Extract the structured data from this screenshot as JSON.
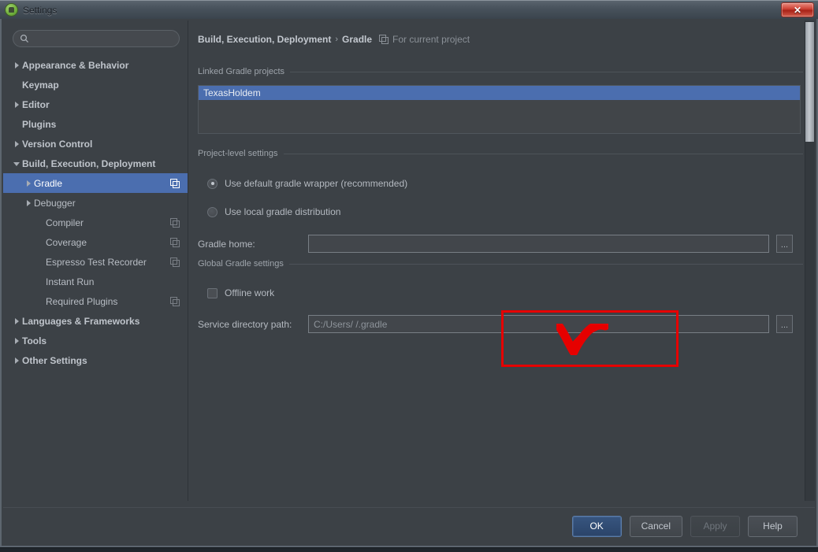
{
  "window": {
    "title": "Settings",
    "app_icon": "android-studio-icon",
    "close_label": "✕"
  },
  "sidebar": {
    "search": {
      "placeholder": "",
      "icon": "search-icon"
    },
    "items": [
      {
        "label": "Appearance & Behavior",
        "depth": 0,
        "arrow": "closed",
        "bold": true,
        "selected": false,
        "scope_icon": false
      },
      {
        "label": "Keymap",
        "depth": 0,
        "arrow": "none",
        "bold": true,
        "selected": false,
        "scope_icon": false
      },
      {
        "label": "Editor",
        "depth": 0,
        "arrow": "closed",
        "bold": true,
        "selected": false,
        "scope_icon": false
      },
      {
        "label": "Plugins",
        "depth": 0,
        "arrow": "none",
        "bold": true,
        "selected": false,
        "scope_icon": false
      },
      {
        "label": "Version Control",
        "depth": 0,
        "arrow": "closed",
        "bold": true,
        "selected": false,
        "scope_icon": false
      },
      {
        "label": "Build, Execution, Deployment",
        "depth": 0,
        "arrow": "open",
        "bold": true,
        "selected": false,
        "scope_icon": false
      },
      {
        "label": "Gradle",
        "depth": 1,
        "arrow": "closed",
        "bold": false,
        "selected": true,
        "scope_icon": true
      },
      {
        "label": "Debugger",
        "depth": 1,
        "arrow": "closed",
        "bold": false,
        "selected": false,
        "scope_icon": false
      },
      {
        "label": "Compiler",
        "depth": 2,
        "arrow": "none",
        "bold": false,
        "selected": false,
        "scope_icon": true
      },
      {
        "label": "Coverage",
        "depth": 2,
        "arrow": "none",
        "bold": false,
        "selected": false,
        "scope_icon": true
      },
      {
        "label": "Espresso Test Recorder",
        "depth": 2,
        "arrow": "none",
        "bold": false,
        "selected": false,
        "scope_icon": true
      },
      {
        "label": "Instant Run",
        "depth": 2,
        "arrow": "none",
        "bold": false,
        "selected": false,
        "scope_icon": false
      },
      {
        "label": "Required Plugins",
        "depth": 2,
        "arrow": "none",
        "bold": false,
        "selected": false,
        "scope_icon": true
      },
      {
        "label": "Languages & Frameworks",
        "depth": 0,
        "arrow": "closed",
        "bold": true,
        "selected": false,
        "scope_icon": false
      },
      {
        "label": "Tools",
        "depth": 0,
        "arrow": "closed",
        "bold": true,
        "selected": false,
        "scope_icon": false
      },
      {
        "label": "Other Settings",
        "depth": 0,
        "arrow": "closed",
        "bold": true,
        "selected": false,
        "scope_icon": false
      }
    ]
  },
  "breadcrumb": {
    "parent": "Build, Execution, Deployment",
    "separator": "›",
    "current": "Gradle",
    "scope_icon": "project-scope-icon",
    "scope_note": "For current project"
  },
  "linked_projects": {
    "group_title": "Linked Gradle projects",
    "items": [
      {
        "label": "TexasHoldem",
        "selected": true
      }
    ]
  },
  "project_level": {
    "group_title": "Project-level settings",
    "radios": [
      {
        "label": "Use default gradle wrapper (recommended)",
        "checked": true
      },
      {
        "label": "Use local gradle distribution",
        "checked": false
      }
    ],
    "gradle_home": {
      "label": "Gradle home:",
      "value": "",
      "placeholder": "",
      "browse_label": "..."
    }
  },
  "global_settings": {
    "group_title": "Global Gradle settings",
    "offline_work": {
      "label": "Offline work",
      "checked": false
    },
    "service_directory": {
      "label": "Service directory path:",
      "value": "C:/Users/          /.gradle",
      "value_visible_prefix": "C:/Users/",
      "value_visible_suffix": "/.gradle",
      "browse_label": "..."
    }
  },
  "annotation": {
    "shape": "rectangle",
    "color": "#e60000",
    "scribble": "redaction-scribble-over-username"
  },
  "footer": {
    "buttons": [
      {
        "label": "OK",
        "style": "default",
        "enabled": true
      },
      {
        "label": "Cancel",
        "style": "normal",
        "enabled": true
      },
      {
        "label": "Apply",
        "style": "disabled",
        "enabled": false
      },
      {
        "label": "Help",
        "style": "normal",
        "enabled": true
      }
    ]
  },
  "scrollbar": {
    "orientation": "vertical",
    "position_percent": 0
  },
  "colors": {
    "dialog_bg": "#3c4146",
    "selection_blue": "#4b6eaf",
    "annotation_red": "#e60000",
    "text_primary": "#b8bdc4",
    "text_muted": "#8b9097"
  }
}
